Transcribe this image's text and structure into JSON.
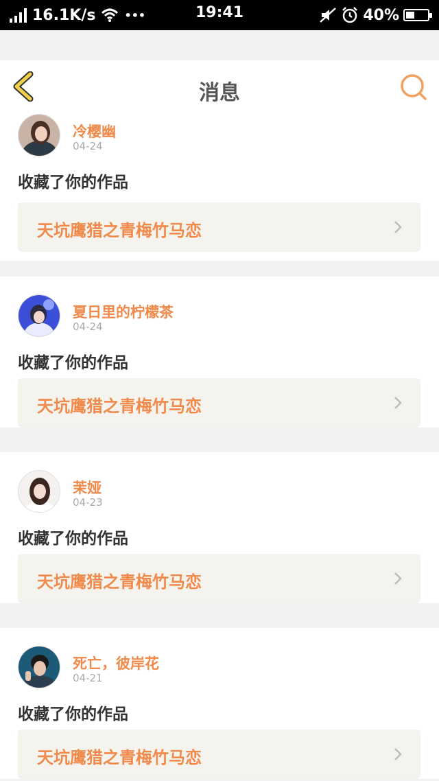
{
  "status_bar": {
    "speed": "16.1K/s",
    "dots": "•••",
    "time": "19:41",
    "battery": "40%",
    "battery_level": 0.4
  },
  "header": {
    "title": "消息",
    "back_icon": "chevron-left-icon",
    "search_icon": "search-icon"
  },
  "colors": {
    "accent": "#f08a4b",
    "back_icon": "#f0d24a",
    "card_bg": "#f4f3ee",
    "page_bg": "#f2f2f2"
  },
  "messages": [
    {
      "user": "冷樱幽",
      "date": "04-24",
      "action": "收藏了你的作品",
      "work": "天坑鹰猎之青梅竹马恋"
    },
    {
      "user": "夏日里的柠檬茶",
      "date": "04-24",
      "action": "收藏了你的作品",
      "work": "天坑鹰猎之青梅竹马恋"
    },
    {
      "user": "茉娅",
      "date": "04-23",
      "action": "收藏了你的作品",
      "work": "天坑鹰猎之青梅竹马恋"
    },
    {
      "user": "死亡，彼岸花",
      "date": "04-21",
      "action": "收藏了你的作品",
      "work": "天坑鹰猎之青梅竹马恋"
    }
  ]
}
